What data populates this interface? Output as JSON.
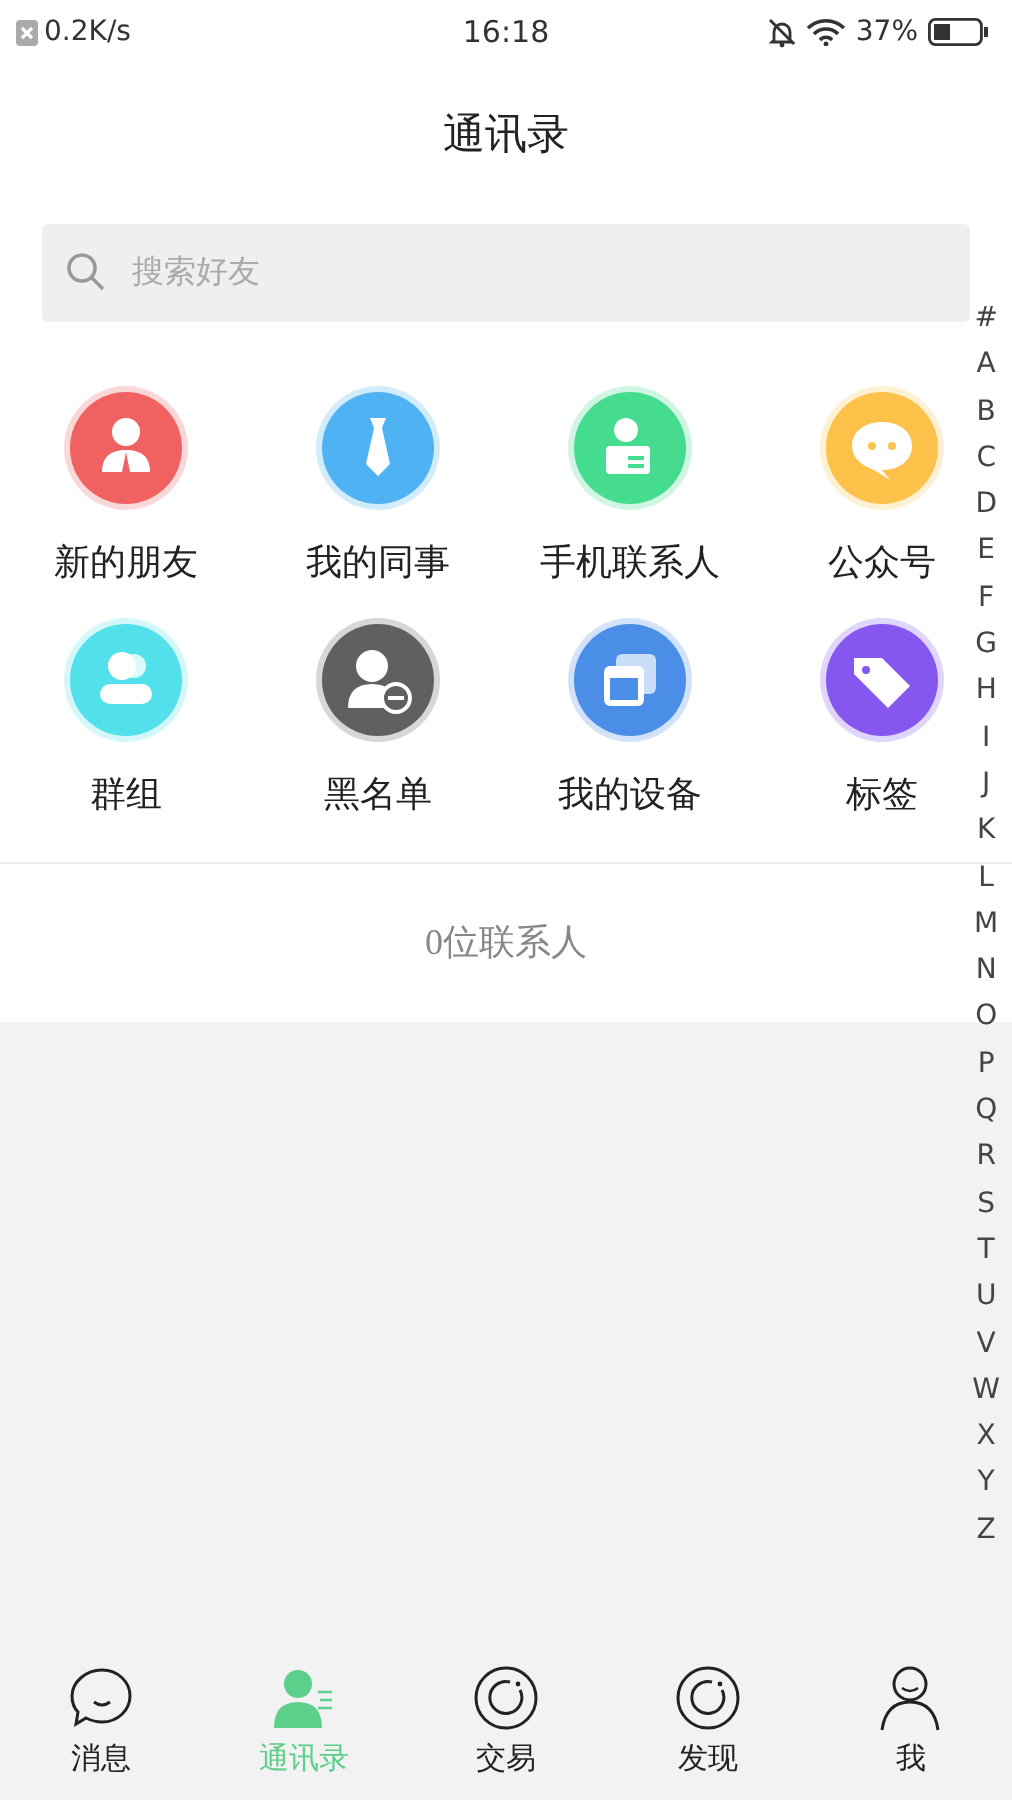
{
  "status_bar": {
    "speed": "0.2K/s",
    "time": "16:18",
    "battery_text": "37%"
  },
  "title": "通讯录",
  "search": {
    "placeholder": "搜索好友"
  },
  "shortcuts": [
    {
      "kind": "person",
      "label": "新的朋友",
      "color": "#f06262"
    },
    {
      "kind": "tie",
      "label": "我的同事",
      "color": "#4fb3f3"
    },
    {
      "kind": "phone-contact",
      "label": "手机联系人",
      "color": "#45dc8f"
    },
    {
      "kind": "chat",
      "label": "公众号",
      "color": "#fcc24a"
    },
    {
      "kind": "group",
      "label": "群组",
      "color": "#52e0ea"
    },
    {
      "kind": "block",
      "label": "黑名单",
      "color": "#606060"
    },
    {
      "kind": "device",
      "label": "我的设备",
      "color": "#4a8ee8"
    },
    {
      "kind": "tag",
      "label": "标签",
      "color": "#8557ee"
    }
  ],
  "contact_count": "0位联系人",
  "index": [
    "#",
    "A",
    "B",
    "C",
    "D",
    "E",
    "F",
    "G",
    "H",
    "I",
    "J",
    "K",
    "L",
    "M",
    "N",
    "O",
    "P",
    "Q",
    "R",
    "S",
    "T",
    "U",
    "V",
    "W",
    "X",
    "Y",
    "Z"
  ],
  "tabs": [
    {
      "kind": "chat",
      "label": "消息",
      "selected": false
    },
    {
      "kind": "contacts",
      "label": "通讯录",
      "selected": true
    },
    {
      "kind": "ring",
      "label": "交易",
      "selected": false
    },
    {
      "kind": "ring",
      "label": "发现",
      "selected": false
    },
    {
      "kind": "user",
      "label": "我",
      "selected": false
    }
  ]
}
